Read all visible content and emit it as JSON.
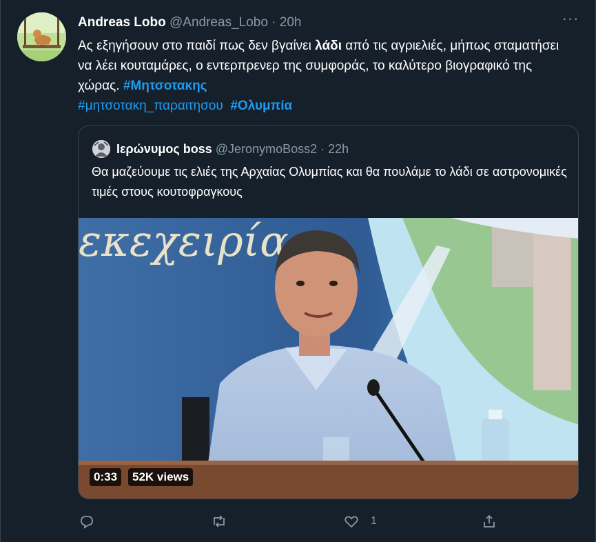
{
  "tweet": {
    "name": "Andreas Lobo",
    "handle": "@Andreas_Lobo",
    "dot": "·",
    "time": "20h",
    "text_part1": "Ας εξηγήσουν στο παιδί πως δεν βγαίνει ",
    "text_bold": "λάδι",
    "text_part2": " από τις αγριελιές, μήπως σταματήσει να λέει κουταμάρες, ο εντερπρενερ της συμφοράς, το καλύτερο βιογραφικό της χώρας. ",
    "hashtag1": "#Μητσοτακης",
    "hashtag2": "#μητσοτακη_παραιτησου",
    "hashtag3": "#Ολυμπία"
  },
  "quote": {
    "name": "Ιερώνυμος boss",
    "handle": "@JeronymoBoss2",
    "dot": "·",
    "time": "22h",
    "text": "Θα μαζεύουμε τις ελιές της Αρχαίας Ολυμπίας και θα  πουλάμε το λάδι σε αστρονομικές τιμές στους κουτοφραγκους",
    "video": {
      "banner_text": "εκεχειρίας",
      "duration": "0:33",
      "views": "52K views"
    }
  },
  "actions": {
    "reply_count": "",
    "retweet_count": "",
    "like_count": "1"
  },
  "colors": {
    "background": "#15202b",
    "accent": "#1d9bf0",
    "muted": "#8899a6"
  }
}
